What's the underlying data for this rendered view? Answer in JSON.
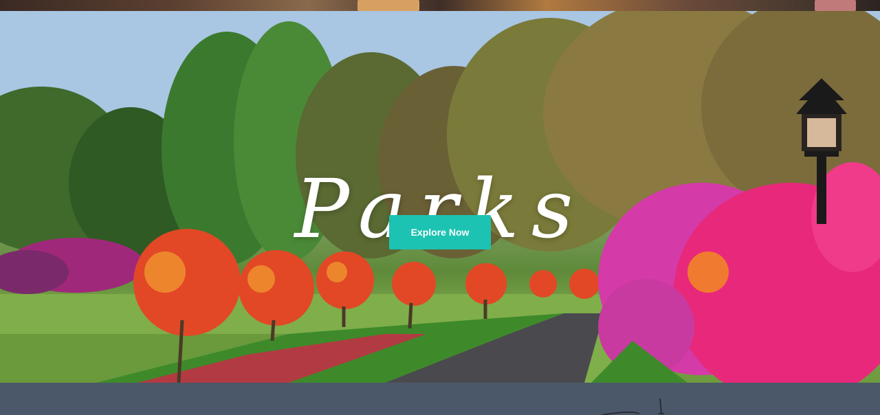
{
  "hero": {
    "title": "Parks",
    "cta_label": "Explore Now"
  },
  "colors": {
    "cta_background": "#1cc3b2",
    "cta_text": "#ffffff",
    "lower_band": "#4b586a"
  },
  "icons": {
    "lamp": "street-lamp-icon"
  }
}
